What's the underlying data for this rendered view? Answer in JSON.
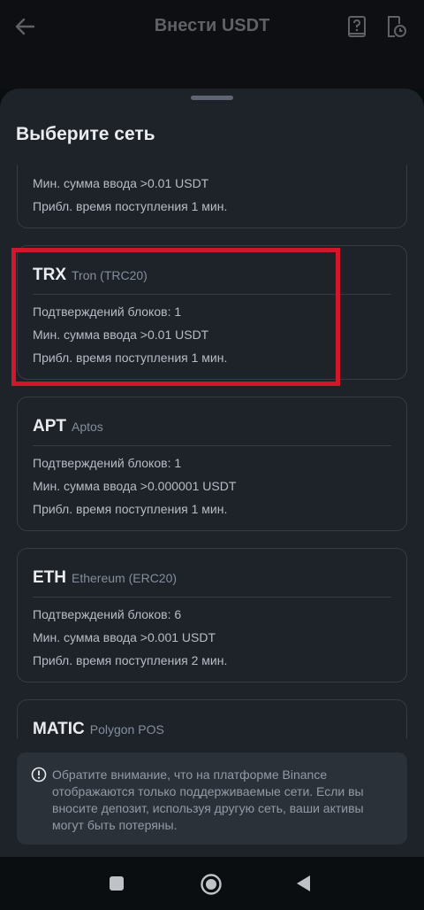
{
  "appbar": {
    "title": "Внести USDT",
    "back_icon": "arrow-left-icon",
    "guide_icon": "question-book-icon",
    "history_icon": "history-doc-icon"
  },
  "sheet": {
    "title": "Выберите сеть"
  },
  "networks": [
    {
      "code": "",
      "name": "",
      "confirmations": "",
      "min_deposit": "Мин. сумма ввода >0.01 USDT",
      "arrival": "Прибл. время поступления 1 мин."
    },
    {
      "code": "TRX",
      "name": "Tron (TRC20)",
      "confirmations": "Подтверждений блоков: 1",
      "min_deposit": "Мин. сумма ввода >0.01 USDT",
      "arrival": "Прибл. время поступления 1 мин."
    },
    {
      "code": "APT",
      "name": "Aptos",
      "confirmations": "Подтверждений блоков: 1",
      "min_deposit": "Мин. сумма ввода >0.000001 USDT",
      "arrival": "Прибл. время поступления 1 мин."
    },
    {
      "code": "ETH",
      "name": "Ethereum (ERC20)",
      "confirmations": "Подтверждений блоков: 6",
      "min_deposit": "Мин. сумма ввода >0.001 USDT",
      "arrival": "Прибл. время поступления 2 мин."
    },
    {
      "code": "MATIC",
      "name": "Polygon POS",
      "confirmations": "",
      "min_deposit": "",
      "arrival": ""
    }
  ],
  "notice": {
    "icon": "info-circle-icon",
    "text": "Обратите внимание, что на платформе Binance отображаются только поддерживаемые сети. Если вы вносите депозит, используя другую сеть, ваши активы могут быть потеряны."
  },
  "colors": {
    "sheet_bg": "#1e2329",
    "card_border": "#363c44",
    "highlight": "#d2172a",
    "text_primary": "#eaecef",
    "text_secondary": "#848e9c"
  },
  "navbar": {
    "icons": [
      "square-recents-icon",
      "circle-home-icon",
      "triangle-back-icon"
    ]
  }
}
